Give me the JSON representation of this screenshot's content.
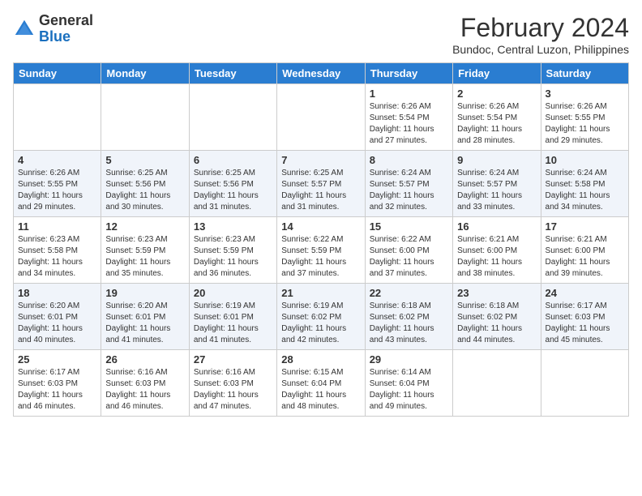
{
  "header": {
    "logo_general": "General",
    "logo_blue": "Blue",
    "month_year": "February 2024",
    "location": "Bundoc, Central Luzon, Philippines"
  },
  "days_of_week": [
    "Sunday",
    "Monday",
    "Tuesday",
    "Wednesday",
    "Thursday",
    "Friday",
    "Saturday"
  ],
  "weeks": [
    [
      {
        "day": "",
        "info": ""
      },
      {
        "day": "",
        "info": ""
      },
      {
        "day": "",
        "info": ""
      },
      {
        "day": "",
        "info": ""
      },
      {
        "day": "1",
        "info": "Sunrise: 6:26 AM\nSunset: 5:54 PM\nDaylight: 11 hours\nand 27 minutes."
      },
      {
        "day": "2",
        "info": "Sunrise: 6:26 AM\nSunset: 5:54 PM\nDaylight: 11 hours\nand 28 minutes."
      },
      {
        "day": "3",
        "info": "Sunrise: 6:26 AM\nSunset: 5:55 PM\nDaylight: 11 hours\nand 29 minutes."
      }
    ],
    [
      {
        "day": "4",
        "info": "Sunrise: 6:26 AM\nSunset: 5:55 PM\nDaylight: 11 hours\nand 29 minutes."
      },
      {
        "day": "5",
        "info": "Sunrise: 6:25 AM\nSunset: 5:56 PM\nDaylight: 11 hours\nand 30 minutes."
      },
      {
        "day": "6",
        "info": "Sunrise: 6:25 AM\nSunset: 5:56 PM\nDaylight: 11 hours\nand 31 minutes."
      },
      {
        "day": "7",
        "info": "Sunrise: 6:25 AM\nSunset: 5:57 PM\nDaylight: 11 hours\nand 31 minutes."
      },
      {
        "day": "8",
        "info": "Sunrise: 6:24 AM\nSunset: 5:57 PM\nDaylight: 11 hours\nand 32 minutes."
      },
      {
        "day": "9",
        "info": "Sunrise: 6:24 AM\nSunset: 5:57 PM\nDaylight: 11 hours\nand 33 minutes."
      },
      {
        "day": "10",
        "info": "Sunrise: 6:24 AM\nSunset: 5:58 PM\nDaylight: 11 hours\nand 34 minutes."
      }
    ],
    [
      {
        "day": "11",
        "info": "Sunrise: 6:23 AM\nSunset: 5:58 PM\nDaylight: 11 hours\nand 34 minutes."
      },
      {
        "day": "12",
        "info": "Sunrise: 6:23 AM\nSunset: 5:59 PM\nDaylight: 11 hours\nand 35 minutes."
      },
      {
        "day": "13",
        "info": "Sunrise: 6:23 AM\nSunset: 5:59 PM\nDaylight: 11 hours\nand 36 minutes."
      },
      {
        "day": "14",
        "info": "Sunrise: 6:22 AM\nSunset: 5:59 PM\nDaylight: 11 hours\nand 37 minutes."
      },
      {
        "day": "15",
        "info": "Sunrise: 6:22 AM\nSunset: 6:00 PM\nDaylight: 11 hours\nand 37 minutes."
      },
      {
        "day": "16",
        "info": "Sunrise: 6:21 AM\nSunset: 6:00 PM\nDaylight: 11 hours\nand 38 minutes."
      },
      {
        "day": "17",
        "info": "Sunrise: 6:21 AM\nSunset: 6:00 PM\nDaylight: 11 hours\nand 39 minutes."
      }
    ],
    [
      {
        "day": "18",
        "info": "Sunrise: 6:20 AM\nSunset: 6:01 PM\nDaylight: 11 hours\nand 40 minutes."
      },
      {
        "day": "19",
        "info": "Sunrise: 6:20 AM\nSunset: 6:01 PM\nDaylight: 11 hours\nand 41 minutes."
      },
      {
        "day": "20",
        "info": "Sunrise: 6:19 AM\nSunset: 6:01 PM\nDaylight: 11 hours\nand 41 minutes."
      },
      {
        "day": "21",
        "info": "Sunrise: 6:19 AM\nSunset: 6:02 PM\nDaylight: 11 hours\nand 42 minutes."
      },
      {
        "day": "22",
        "info": "Sunrise: 6:18 AM\nSunset: 6:02 PM\nDaylight: 11 hours\nand 43 minutes."
      },
      {
        "day": "23",
        "info": "Sunrise: 6:18 AM\nSunset: 6:02 PM\nDaylight: 11 hours\nand 44 minutes."
      },
      {
        "day": "24",
        "info": "Sunrise: 6:17 AM\nSunset: 6:03 PM\nDaylight: 11 hours\nand 45 minutes."
      }
    ],
    [
      {
        "day": "25",
        "info": "Sunrise: 6:17 AM\nSunset: 6:03 PM\nDaylight: 11 hours\nand 46 minutes."
      },
      {
        "day": "26",
        "info": "Sunrise: 6:16 AM\nSunset: 6:03 PM\nDaylight: 11 hours\nand 46 minutes."
      },
      {
        "day": "27",
        "info": "Sunrise: 6:16 AM\nSunset: 6:03 PM\nDaylight: 11 hours\nand 47 minutes."
      },
      {
        "day": "28",
        "info": "Sunrise: 6:15 AM\nSunset: 6:04 PM\nDaylight: 11 hours\nand 48 minutes."
      },
      {
        "day": "29",
        "info": "Sunrise: 6:14 AM\nSunset: 6:04 PM\nDaylight: 11 hours\nand 49 minutes."
      },
      {
        "day": "",
        "info": ""
      },
      {
        "day": "",
        "info": ""
      }
    ]
  ]
}
